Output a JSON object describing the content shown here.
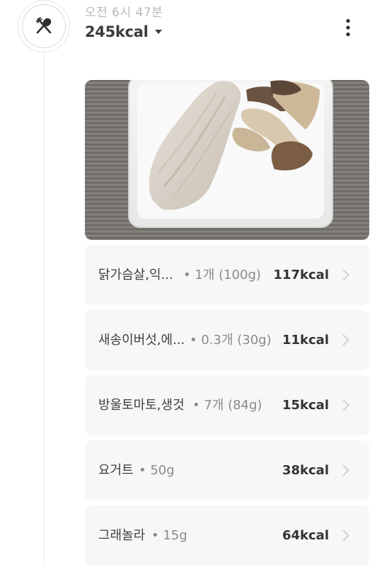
{
  "meal": {
    "time": "오전 6시 47분",
    "total_kcal": "245kcal",
    "icons": {
      "meal": "fork-spoon-icon",
      "dropdown": "caret-down-icon",
      "more": "vertical-dots-icon",
      "chevron": "chevron-right-icon"
    }
  },
  "photo": {
    "description_icon": "meal-photo"
  },
  "foods": [
    {
      "name": "닭가슴살,익...",
      "amount": "• 1개 (100g)",
      "kcal": "117kcal"
    },
    {
      "name": "새송이버섯,에...",
      "amount": "• 0.3개 (30g)",
      "kcal": "11kcal"
    },
    {
      "name": "방울토마토,생것",
      "amount": "• 7개 (84g)",
      "kcal": "15kcal"
    },
    {
      "name": "요거트",
      "amount": "• 50g",
      "kcal": "38kcal"
    },
    {
      "name": "그래놀라",
      "amount": "• 15g",
      "kcal": "64kcal"
    }
  ],
  "colors": {
    "card_bg": "#f7f7f7",
    "muted_text": "#b8b8b8",
    "accent_dark": "#333333"
  }
}
